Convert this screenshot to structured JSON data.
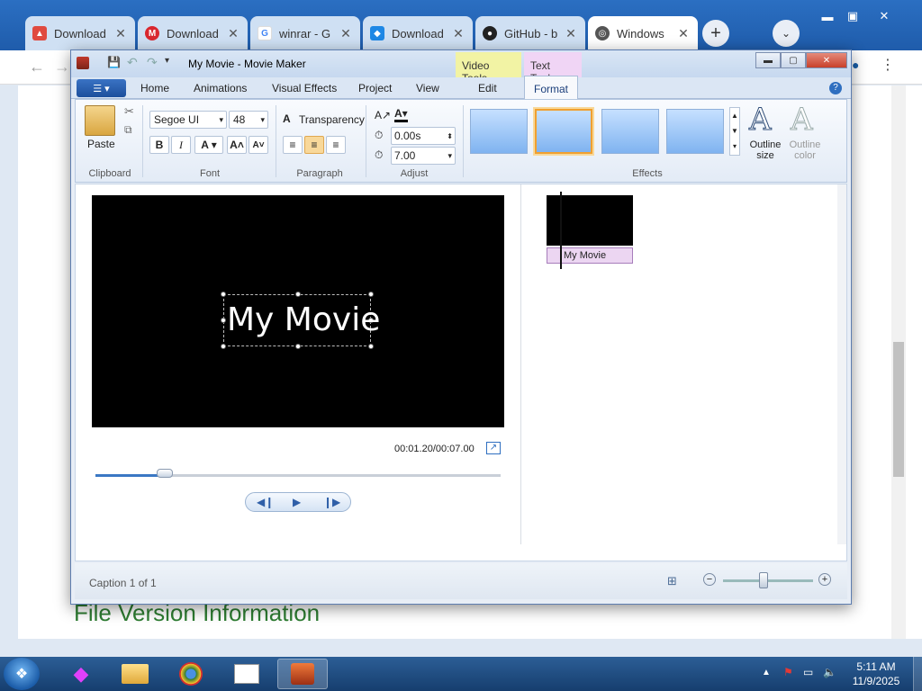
{
  "chrome": {
    "tabs": [
      {
        "title": "Download",
        "favicon": "store-icon",
        "color": "#e04a3f"
      },
      {
        "title": "Download",
        "favicon": "mega-icon",
        "color": "#d9272e"
      },
      {
        "title": "winrar - G",
        "favicon": "google-icon",
        "color": "#4285f4"
      },
      {
        "title": "Download",
        "favicon": "download-diamond-icon",
        "color": "#1e88e5"
      },
      {
        "title": "GitHub - b",
        "favicon": "github-icon",
        "color": "#222222"
      },
      {
        "title": "Windows",
        "favicon": "globe-icon",
        "color": "#555555",
        "active": true
      }
    ],
    "page_heading": "File Version Information"
  },
  "moviemaker": {
    "title": "My Movie - Movie Maker",
    "context_tabs": {
      "video_tools": "Video Tools",
      "text_tools": "Text Tools"
    },
    "ribbon_tabs": [
      "Home",
      "Animations",
      "Visual Effects",
      "Project",
      "View",
      "Edit",
      "Format"
    ],
    "active_tab": "Format",
    "groups": {
      "clipboard": {
        "label": "Clipboard",
        "paste": "Paste"
      },
      "font": {
        "label": "Font",
        "family": "Segoe UI",
        "size": "48"
      },
      "paragraph": {
        "label": "Paragraph",
        "transparency": "Transparency"
      },
      "adjust": {
        "label": "Adjust",
        "start_time": "0.00s",
        "duration": "7.00"
      },
      "effects": {
        "label": "Effects",
        "outline_size": "Outline size",
        "outline_color": "Outline color"
      }
    },
    "preview": {
      "caption": "My Movie",
      "time": "00:01.20/00:07.00",
      "progress": 0.17
    },
    "storyboard": {
      "caption_label": "My Movie"
    },
    "status": {
      "text": "Caption 1 of 1"
    },
    "colors": {
      "accent": "#f0a030",
      "caption_bg": "#ecd6f2"
    }
  },
  "taskbar": {
    "items": [
      "start-orb",
      "cat-app-icon",
      "file-explorer-icon",
      "chrome-icon",
      "task-list-icon",
      "movie-maker-icon"
    ],
    "time": "5:11 AM",
    "date": "11/9/2025"
  }
}
